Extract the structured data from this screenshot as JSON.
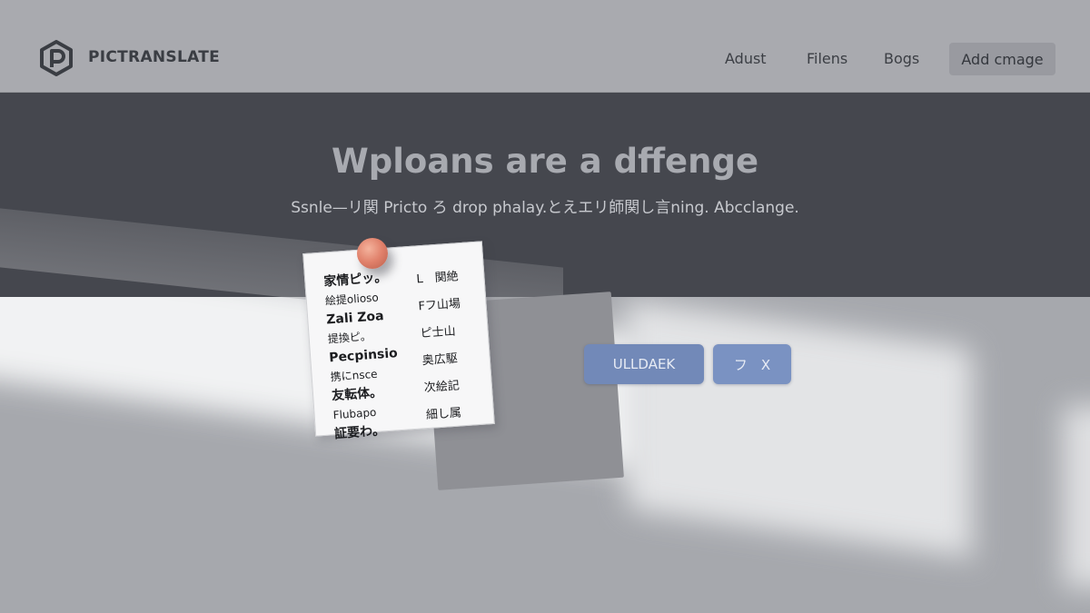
{
  "header": {
    "brand": "PICTRANSLATE",
    "nav": [
      "Adust",
      "Filens",
      "Bogs"
    ],
    "cta_label": "Add cmage"
  },
  "hero": {
    "title": "Wploans are a dffenge",
    "subtitle": "Ssnle—リ関 Pricto ろ drop phalay.とえエリ師関し言ning. Abcclange."
  },
  "note": {
    "left_lines": [
      "家情ピッ。",
      "絵提olioso",
      "Zali Zoa",
      "提換ピ。",
      "Pecpinsio",
      "携にnsce",
      "友転体。",
      "Flubapo",
      "証要わ。"
    ],
    "right_lines": [
      "L　関絶",
      "Fフ山場",
      "ピ士山",
      "奥広駆",
      "次絵記",
      "細し属"
    ]
  },
  "actions": {
    "upload_label": "ULLDAEK",
    "x_label": "フ　X"
  },
  "colors": {
    "hero_bg": "#45474e",
    "button_blue": "#7289b8",
    "pin": "#e0806a"
  },
  "icons": {
    "logo": "hexagon-p-logo-icon"
  }
}
